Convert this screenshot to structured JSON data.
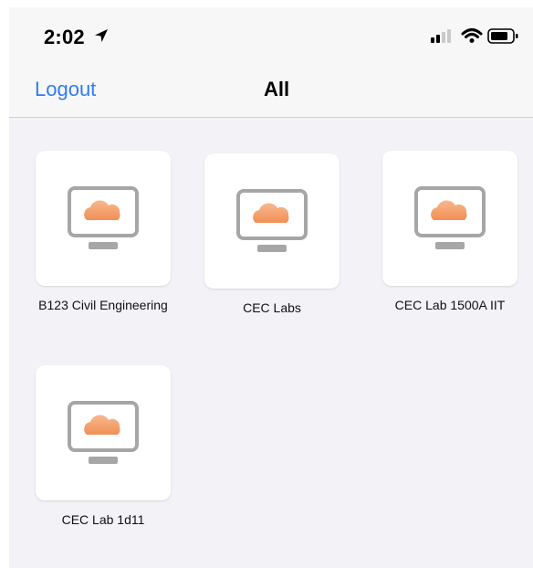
{
  "status_bar": {
    "time": "2:02",
    "location_icon": "location-arrow-icon",
    "signal_icon": "cellular-signal-icon",
    "wifi_icon": "wifi-icon",
    "battery_icon": "battery-icon"
  },
  "nav_bar": {
    "logout_label": "Logout",
    "title": "All"
  },
  "desktops": [
    {
      "label": "B123 Civil Engineering",
      "icon": "cloud-monitor-icon"
    },
    {
      "label": "CEC Labs",
      "icon": "cloud-monitor-icon"
    },
    {
      "label": "CEC Lab 1500A IIT",
      "icon": "cloud-monitor-icon"
    },
    {
      "label": "CEC Lab 1d11",
      "icon": "cloud-monitor-icon"
    }
  ],
  "colors": {
    "accent": "#2f7cf6",
    "cloud_start": "#f9b88e",
    "cloud_end": "#f08f55",
    "monitor": "#a6a6a6"
  }
}
